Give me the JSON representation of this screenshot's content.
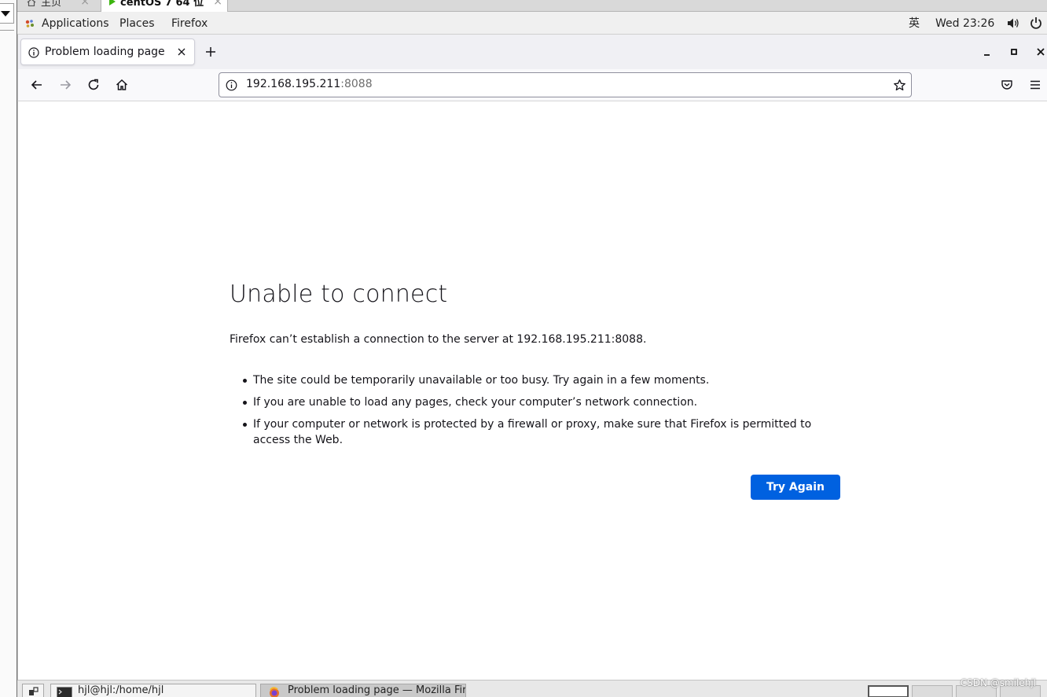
{
  "host": {
    "tabs": [
      {
        "label": "主页",
        "active": false
      },
      {
        "label": "centOS 7 64 位",
        "active": true
      }
    ]
  },
  "gnome_bar": {
    "applications": "Applications",
    "places": "Places",
    "firefox": "Firefox",
    "input_method": "英",
    "clock": "Wed 23:26",
    "icons": [
      "volume-icon",
      "power-icon"
    ]
  },
  "browser": {
    "tab_title": "Problem loading page",
    "url_host": "192.168.195.211",
    "url_port": ":8088",
    "icons": [
      "back-icon",
      "forward-icon",
      "reload-icon",
      "home-icon",
      "info-icon",
      "bookmark-star-icon",
      "pocket-icon",
      "menu-icon"
    ]
  },
  "error": {
    "title": "Unable to connect",
    "description": "Firefox can’t establish a connection to the server at 192.168.195.211:8088.",
    "tips": [
      "The site could be temporarily unavailable or too busy. Try again in a few moments.",
      "If you are unable to load any pages, check your computer’s network connection.",
      "If your computer or network is protected by a firewall or proxy, make sure that Firefox is permitted to access the Web."
    ],
    "button": "Try Again",
    "button_color": "#0061e0"
  },
  "taskbar": {
    "items": [
      {
        "label": "hjl@hjl:/home/hjl",
        "active": false
      },
      {
        "label": "Problem loading page — Mozilla Fire",
        "active": true
      }
    ],
    "workspaces": 4
  },
  "watermark": "CSDN @smilehjl"
}
